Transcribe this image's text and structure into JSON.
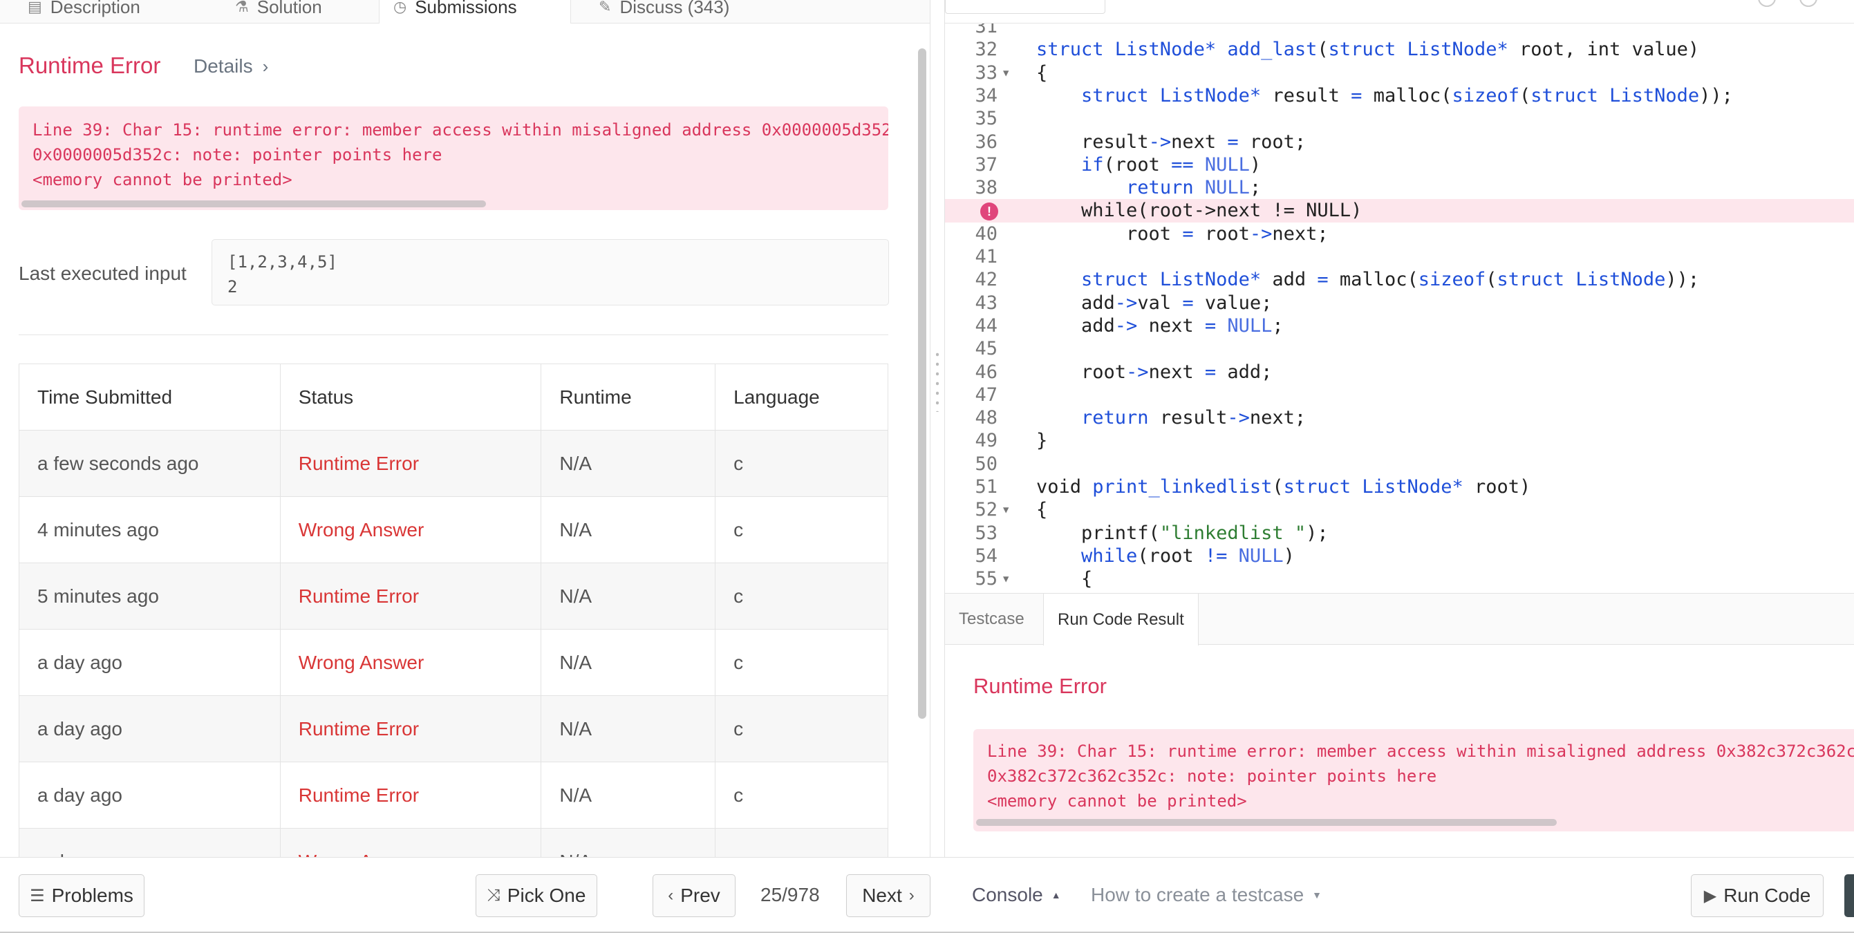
{
  "top_tabs": [
    {
      "label": "Description",
      "icon": "document-icon"
    },
    {
      "label": "Solution",
      "icon": "flask-icon"
    },
    {
      "label": "Submissions",
      "icon": "clock-icon"
    },
    {
      "label": "Discuss (343)",
      "icon": "chat-icon"
    }
  ],
  "result": {
    "status": "Runtime Error",
    "details_label": "Details",
    "error_lines": [
      "Line 39: Char 15: runtime error: member access within misaligned address 0x0000005d352",
      "0x0000005d352c: note: pointer points here",
      "<memory cannot be printed>"
    ],
    "last_input_label": "Last executed input",
    "last_input": "[1,2,3,4,5]\n2"
  },
  "submissions": {
    "headers": [
      "Time Submitted",
      "Status",
      "Runtime",
      "Language"
    ],
    "rows": [
      [
        "a few seconds ago",
        "Runtime Error",
        "N/A",
        "c"
      ],
      [
        "4 minutes ago",
        "Wrong Answer",
        "N/A",
        "c"
      ],
      [
        "5 minutes ago",
        "Runtime Error",
        "N/A",
        "c"
      ],
      [
        "a day ago",
        "Wrong Answer",
        "N/A",
        "c"
      ],
      [
        "a day ago",
        "Runtime Error",
        "N/A",
        "c"
      ],
      [
        "a day ago",
        "Runtime Error",
        "N/A",
        "c"
      ],
      [
        "a day ago",
        "Wrong Answer",
        "N/A",
        "c"
      ]
    ]
  },
  "editor": {
    "error_line": "39",
    "lines": [
      {
        "n": "31",
        "fold": false,
        "html": ""
      },
      {
        "n": "32",
        "fold": false,
        "html": "<span class=\"kw\">struct ListNode*</span> <span class=\"kw\">add_last</span>(<span class=\"kw\">struct ListNode*</span> root, int value)"
      },
      {
        "n": "33",
        "fold": true,
        "html": "{"
      },
      {
        "n": "34",
        "fold": false,
        "html": "    <span class=\"kw\">struct ListNode*</span> result <span class=\"kw\">=</span> malloc(<span class=\"kw\">sizeof</span>(<span class=\"kw\">struct ListNode</span>));"
      },
      {
        "n": "35",
        "fold": false,
        "html": ""
      },
      {
        "n": "36",
        "fold": false,
        "html": "    result<span class=\"kw\">-&gt;</span>next <span class=\"kw\">=</span> root;"
      },
      {
        "n": "37",
        "fold": false,
        "html": "    <span class=\"kw\">if</span>(root <span class=\"kw\">==</span> <span class=\"nl\">NULL</span>)"
      },
      {
        "n": "38",
        "fold": false,
        "html": "        <span class=\"kw\">return</span> <span class=\"nl\">NULL</span>;"
      },
      {
        "n": "39",
        "fold": false,
        "html": "    while(root-&gt;next != NULL)"
      },
      {
        "n": "40",
        "fold": false,
        "html": "        root <span class=\"kw\">=</span> root<span class=\"kw\">-&gt;</span>next;"
      },
      {
        "n": "41",
        "fold": false,
        "html": ""
      },
      {
        "n": "42",
        "fold": false,
        "html": "    <span class=\"kw\">struct ListNode*</span> add <span class=\"kw\">=</span> malloc(<span class=\"kw\">sizeof</span>(<span class=\"kw\">struct ListNode</span>));"
      },
      {
        "n": "43",
        "fold": false,
        "html": "    add<span class=\"kw\">-&gt;</span>val <span class=\"kw\">=</span> value;"
      },
      {
        "n": "44",
        "fold": false,
        "html": "    add<span class=\"kw\">-&gt;</span> next <span class=\"kw\">=</span> <span class=\"nl\">NULL</span>;"
      },
      {
        "n": "45",
        "fold": false,
        "html": ""
      },
      {
        "n": "46",
        "fold": false,
        "html": "    root<span class=\"kw\">-&gt;</span>next <span class=\"kw\">=</span> add;"
      },
      {
        "n": "47",
        "fold": false,
        "html": ""
      },
      {
        "n": "48",
        "fold": false,
        "html": "    <span class=\"kw\">return</span> result<span class=\"kw\">-&gt;</span>next;"
      },
      {
        "n": "49",
        "fold": false,
        "html": "}"
      },
      {
        "n": "50",
        "fold": false,
        "html": ""
      },
      {
        "n": "51",
        "fold": false,
        "html": "void <span class=\"kw\">print_linkedlist</span>(<span class=\"kw\">struct ListNode*</span> root)"
      },
      {
        "n": "52",
        "fold": true,
        "html": "{"
      },
      {
        "n": "53",
        "fold": false,
        "html": "    printf(<span class=\"st\">\"linkedlist \"</span>);"
      },
      {
        "n": "54",
        "fold": false,
        "html": "    <span class=\"kw\">while</span>(root <span class=\"kw\">!=</span> <span class=\"nl\">NULL</span>)"
      },
      {
        "n": "55",
        "fold": true,
        "html": "    {"
      }
    ]
  },
  "console": {
    "tabs": [
      "Testcase",
      "Run Code Result"
    ],
    "active_tab": 1,
    "status": "Runtime Error",
    "error_lines": [
      "Line 39: Char 15: runtime error: member access within misaligned address 0x382c372c362c",
      "0x382c372c362c352c: note: pointer points here",
      "<memory cannot be printed>"
    ]
  },
  "footer": {
    "problems_label": "Problems",
    "pick_one_label": "Pick One",
    "prev_label": "Prev",
    "page_counter": "25/978",
    "next_label": "Next",
    "console_label": "Console",
    "testcase_help_label": "How to create a testcase",
    "run_code_label": "Run Code"
  },
  "colors": {
    "error_red": "#d9365c",
    "status_red": "#d93636",
    "error_bg": "#fde6ec",
    "keyword_blue": "#1f4fd9"
  }
}
